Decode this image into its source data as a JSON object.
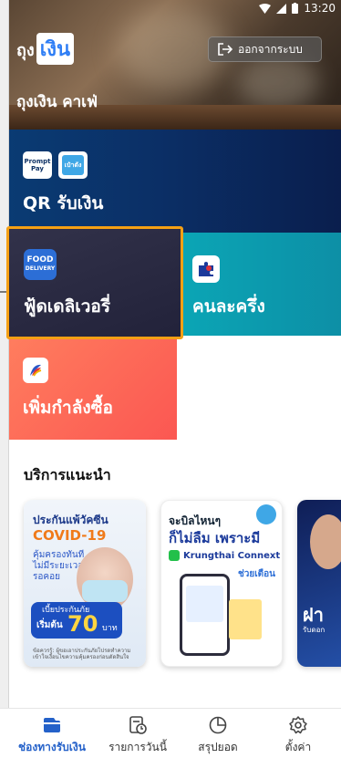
{
  "status_bar": {
    "time": "13:20"
  },
  "header": {
    "logo_part1": "ถุง",
    "logo_part2": "เงิน",
    "logout_label": "ออกจากระบบ",
    "shop_name": "ถุงเงิน คาเฟ่"
  },
  "tiles": {
    "qr": {
      "label": "QR รับเงิน",
      "promptpay_text1": "Prompt",
      "promptpay_text2": "Pay",
      "paotang_text": "เป๋าตัง"
    },
    "food": {
      "label": "ฟู้ดเดลิเวอรี่",
      "icon_text1": "FOOD",
      "icon_text2": "DELIVERY"
    },
    "half": {
      "label": "คนละครึ่ง"
    },
    "buy": {
      "label": "เพิ่มกำลังซื้อ"
    }
  },
  "recommended": {
    "title": "บริการแนะนำ",
    "cards": [
      {
        "line1": "ประกันแพ้วัคซีน",
        "line2": "COVID-19",
        "line3": "คุ้มครองทันที ไม่มีระยะเวลารอคอย",
        "badge_line1": "เบี้ยประกันภัย",
        "badge_prefix": "เริ่มต้น",
        "badge_amount": "70",
        "badge_unit": "บาท",
        "footnote": "ข้อควรรู้: ผู้ขอเอาประกันภัยโปรดทำความเข้าใจเงื่อนไขความคุ้มครองก่อนตัดสินใจ"
      },
      {
        "line1": "จะบิลไหนๆ",
        "line2": "ก็ไม่ลืม เพราะมี",
        "brand": "Krungthai Connext",
        "line3": "ช่วยเตือน"
      },
      {
        "line1": "ฝา",
        "line2": "รับดอก"
      }
    ]
  },
  "bottom_nav": [
    {
      "label": "ช่องทางรับเงิน",
      "icon": "wallet-icon",
      "active": true
    },
    {
      "label": "รายการวันนี้",
      "icon": "receipt-clock-icon",
      "active": false
    },
    {
      "label": "สรุปยอด",
      "icon": "pie-chart-icon",
      "active": false
    },
    {
      "label": "ตั้งค่า",
      "icon": "gear-icon",
      "active": false
    }
  ],
  "colors": {
    "accent": "#2461c9",
    "food_highlight": "#f5a014",
    "qr_tile": "#0b2f66",
    "food_tile": "#22223a",
    "half_tile": "#0ba5b5",
    "buy_tile": "#fb5752"
  }
}
